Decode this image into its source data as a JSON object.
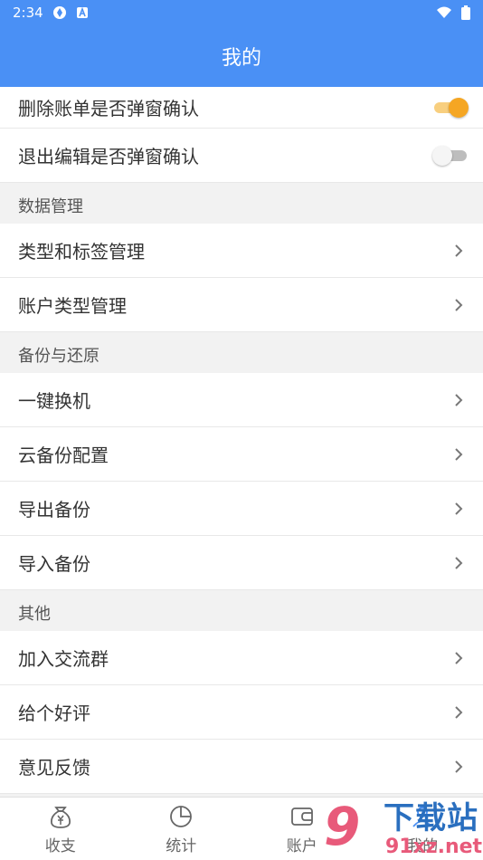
{
  "status": {
    "time": "2:34"
  },
  "appbar": {
    "title": "我的"
  },
  "rows_top": [
    {
      "label": "删除账单是否弹窗确认",
      "toggle": "on"
    },
    {
      "label": "退出编辑是否弹窗确认",
      "toggle": "off"
    }
  ],
  "sections": {
    "data_mgmt": {
      "title": "数据管理",
      "items": [
        "类型和标签管理",
        "账户类型管理"
      ]
    },
    "backup": {
      "title": "备份与还原",
      "items": [
        "一键换机",
        "云备份配置",
        "导出备份",
        "导入备份"
      ]
    },
    "other": {
      "title": "其他",
      "items": [
        "加入交流群",
        "给个好评",
        "意见反馈"
      ]
    }
  },
  "tabs": [
    "收支",
    "统计",
    "账户",
    "我的"
  ],
  "watermark": {
    "big": "9",
    "top": "下载站",
    "bottom": "91xz.net"
  },
  "colors": {
    "primary": "#4a90f5",
    "toggle_on": "#f5a623",
    "watermark_pink": "#e85a7a",
    "watermark_blue": "#2a6fbf"
  }
}
